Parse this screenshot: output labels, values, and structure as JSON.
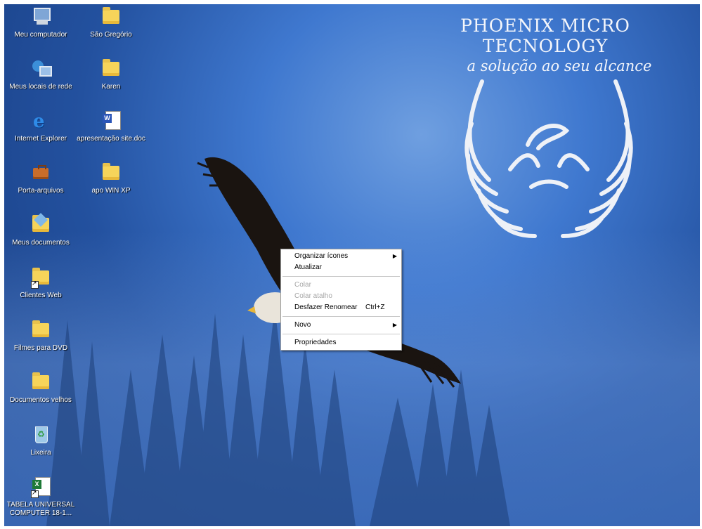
{
  "desktop_icons": [
    {
      "label": "Meu computador",
      "icon": "my-computer-icon"
    },
    {
      "label": "São Gregório",
      "icon": "folder-icon"
    },
    {
      "label": "Meus locais de rede",
      "icon": "network-places-icon"
    },
    {
      "label": "Karen",
      "icon": "folder-icon"
    },
    {
      "label": "Internet Explorer",
      "icon": "internet-explorer-icon"
    },
    {
      "label": "apresentação site.doc",
      "icon": "word-document-icon"
    },
    {
      "label": "Porta-arquivos",
      "icon": "briefcase-icon"
    },
    {
      "label": "apo WIN XP",
      "icon": "folder-icon"
    },
    {
      "label": "Meus documentos",
      "icon": "my-documents-icon"
    },
    {
      "label": "Clientes Web",
      "icon": "folder-shortcut-icon"
    },
    {
      "label": "Filmes para DVD",
      "icon": "folder-icon"
    },
    {
      "label": "Documentos velhos",
      "icon": "folder-icon"
    },
    {
      "label": "Lixeira",
      "icon": "recycle-bin-icon"
    },
    {
      "label": "TABELA UNIVERSAL COMPUTER 18-1...",
      "icon": "excel-shortcut-icon"
    }
  ],
  "wallpaper": {
    "title": "PHOENIX MICRO TECNOLOGY",
    "subtitle": "a solução ao seu alcance",
    "text_color": "#f4f6fb",
    "sky_color": "#2f63b8"
  },
  "context_menu": {
    "items": [
      {
        "label": "Organizar ícones",
        "enabled": true,
        "submenu": true
      },
      {
        "label": "Atualizar",
        "enabled": true
      },
      {
        "label": "Colar",
        "enabled": false
      },
      {
        "label": "Colar atalho",
        "enabled": false
      },
      {
        "label": "Desfazer Renomear",
        "shortcut": "Ctrl+Z",
        "enabled": true
      },
      {
        "label": "Novo",
        "enabled": true,
        "submenu": true
      },
      {
        "label": "Propriedades",
        "enabled": true
      }
    ]
  }
}
